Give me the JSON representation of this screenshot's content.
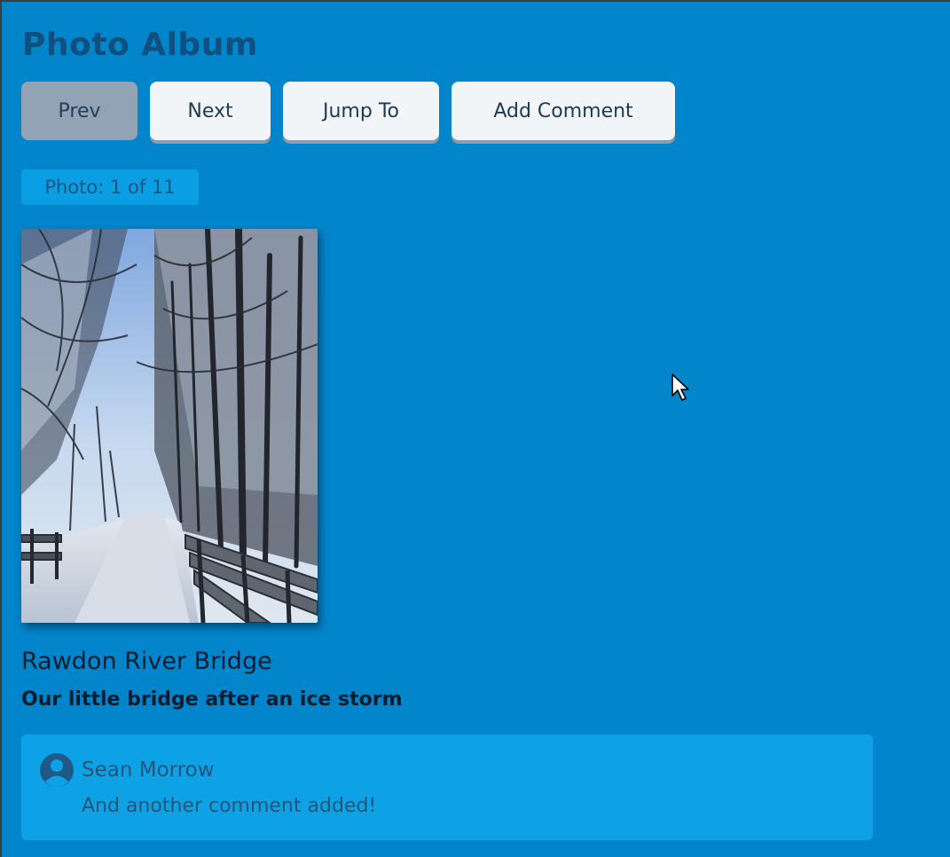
{
  "app": {
    "title": "Photo Album"
  },
  "toolbar": {
    "prev_label": "Prev",
    "next_label": "Next",
    "jump_label": "Jump To",
    "add_comment_label": "Add Comment"
  },
  "counter": {
    "text": "Photo: 1 of 11"
  },
  "photo": {
    "title": "Rawdon River Bridge",
    "description": "Our little bridge after an ice storm"
  },
  "comments": [
    {
      "author": "Sean Morrow",
      "text": "And another comment added!"
    }
  ],
  "colors": {
    "background": "#0385cc",
    "title": "#10507f",
    "button_bg": "#f2f5f8",
    "button_disabled_bg": "#92a3b6",
    "counter_bg": "#0a9ee2",
    "comment_bg": "#0da2e6"
  }
}
